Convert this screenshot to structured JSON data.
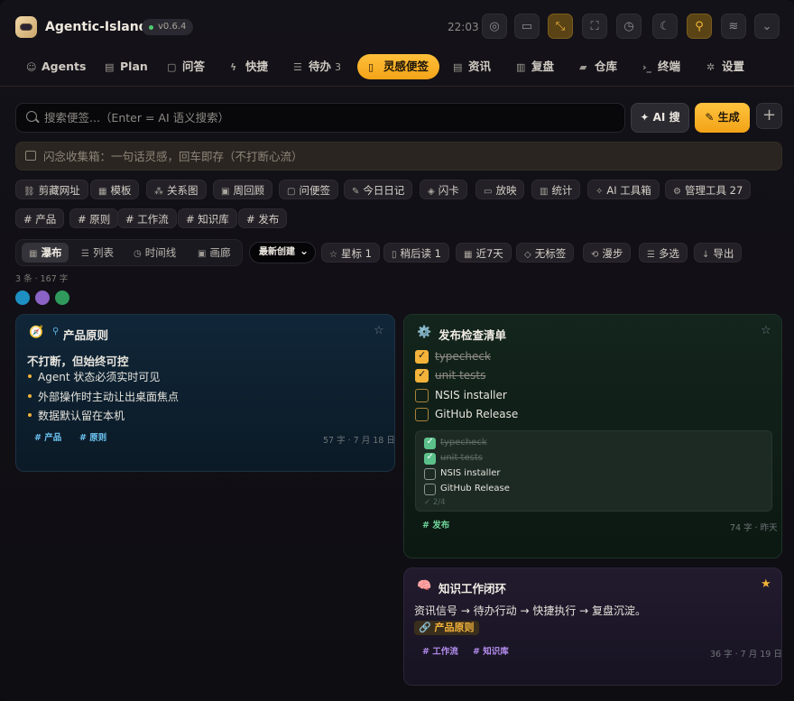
{
  "app": {
    "name": "Agentic-Island",
    "version": "v0.6.4",
    "clock": "22:03"
  },
  "titlebar_buttons": [
    {
      "name": "camera-icon",
      "glyph": "◎"
    },
    {
      "name": "video-icon",
      "glyph": "▭"
    },
    {
      "name": "compress-icon",
      "glyph": "⤡",
      "active": true
    },
    {
      "name": "fullscreen-icon",
      "glyph": "⛶"
    },
    {
      "name": "timer-icon",
      "glyph": "◷"
    },
    {
      "name": "moon-icon",
      "glyph": "☾"
    },
    {
      "name": "pin-icon",
      "glyph": "⚲",
      "active": true
    },
    {
      "name": "waves-icon",
      "glyph": "≋"
    },
    {
      "name": "chevron-down-icon",
      "glyph": "⌄"
    }
  ],
  "nav": [
    {
      "label": "Agents",
      "icon": "☺"
    },
    {
      "label": "Plan",
      "icon": "▤"
    },
    {
      "label": "问答",
      "icon": "▢"
    },
    {
      "label": "快捷",
      "icon": "ϟ"
    },
    {
      "label": "待办",
      "icon": "☰",
      "count": "3"
    },
    {
      "label": "灵感便签",
      "icon": "▯",
      "active": true
    },
    {
      "label": "资讯",
      "icon": "▤"
    },
    {
      "label": "复盘",
      "icon": "▥"
    },
    {
      "label": "仓库",
      "icon": "▰"
    },
    {
      "label": "终端",
      "icon": "›_"
    },
    {
      "label": "设置",
      "icon": "✲"
    }
  ],
  "search": {
    "placeholder": "搜索便签...（Enter = AI 语义搜索）"
  },
  "buttons": {
    "ai_search": "✦ AI 搜",
    "generate": "✎ 生成",
    "add": "+"
  },
  "inbox": {
    "placeholder": "闪念收集箱：一句话灵感，回车即存（不打断心流）"
  },
  "tools": [
    {
      "label": "剪藏网址",
      "icon": "⛓"
    },
    {
      "label": "模板",
      "icon": "▦"
    },
    {
      "label": "关系图",
      "icon": "⁂"
    },
    {
      "label": "周回顾",
      "icon": "▣"
    },
    {
      "label": "问便签",
      "icon": "▢"
    },
    {
      "label": "今日日记",
      "icon": "✎"
    },
    {
      "label": "闪卡",
      "icon": "◈"
    },
    {
      "label": "放映",
      "icon": "▭"
    },
    {
      "label": "统计",
      "icon": "▥"
    },
    {
      "label": "AI 工具箱",
      "icon": "✧"
    },
    {
      "label": "管理工具 27",
      "icon": "⚙"
    }
  ],
  "topic_tags": [
    "# 产品",
    "# 原则",
    "# 工作流",
    "# 知识库",
    "# 发布"
  ],
  "views": [
    {
      "label": "瀑布",
      "icon": "▦",
      "active": true
    },
    {
      "label": "列表",
      "icon": "☰"
    },
    {
      "label": "时间线",
      "icon": "◷"
    },
    {
      "label": "画廊",
      "icon": "▣"
    }
  ],
  "sort": "最新创建",
  "filters": [
    {
      "label": "星标 1",
      "icon": "☆"
    },
    {
      "label": "稍后读 1",
      "icon": "▯"
    },
    {
      "label": "近7天",
      "icon": "▦"
    },
    {
      "label": "无标签",
      "icon": "◇"
    },
    {
      "label": "漫步",
      "icon": "⟲"
    },
    {
      "label": "多选",
      "icon": "☰"
    },
    {
      "label": "导出",
      "icon": "↓"
    }
  ],
  "stats": "3 条 · 167 字",
  "colors": {
    "dot1": "#1e8fc2",
    "dot2": "#8b62c6",
    "dot3": "#2f9a5c",
    "accent": "#f3b23a"
  },
  "cards": {
    "principles": {
      "emoji": "🧭",
      "pin": "⚲",
      "title": "产品原则",
      "heading": "不打断，但始终可控",
      "bullets": [
        "Agent 状态必须实时可见",
        "外部操作时主动让出桌面焦点",
        "数据默认留在本机"
      ],
      "tags": [
        "# 产品",
        "# 原则"
      ],
      "meta": "57 字 · 7 月 18 日"
    },
    "release": {
      "emoji": "⚙️",
      "title": "发布检查清单",
      "items": [
        {
          "label": "typecheck",
          "done": true
        },
        {
          "label": "unit tests",
          "done": true
        },
        {
          "label": "NSIS installer",
          "done": false
        },
        {
          "label": "GitHub Release",
          "done": false
        }
      ],
      "progress": "✓ 2/4",
      "tags": [
        "# 发布"
      ],
      "meta": "74 字 · 昨天"
    },
    "knowledge": {
      "emoji": "🧠",
      "title": "知识工作闭环",
      "text": "资讯信号 → 待办行动 → 快捷执行 → 复盘沉淀。",
      "link": "🔗 产品原则",
      "tags": [
        "# 工作流",
        "# 知识库"
      ],
      "meta": "36 字 · 7 月 19 日"
    }
  }
}
